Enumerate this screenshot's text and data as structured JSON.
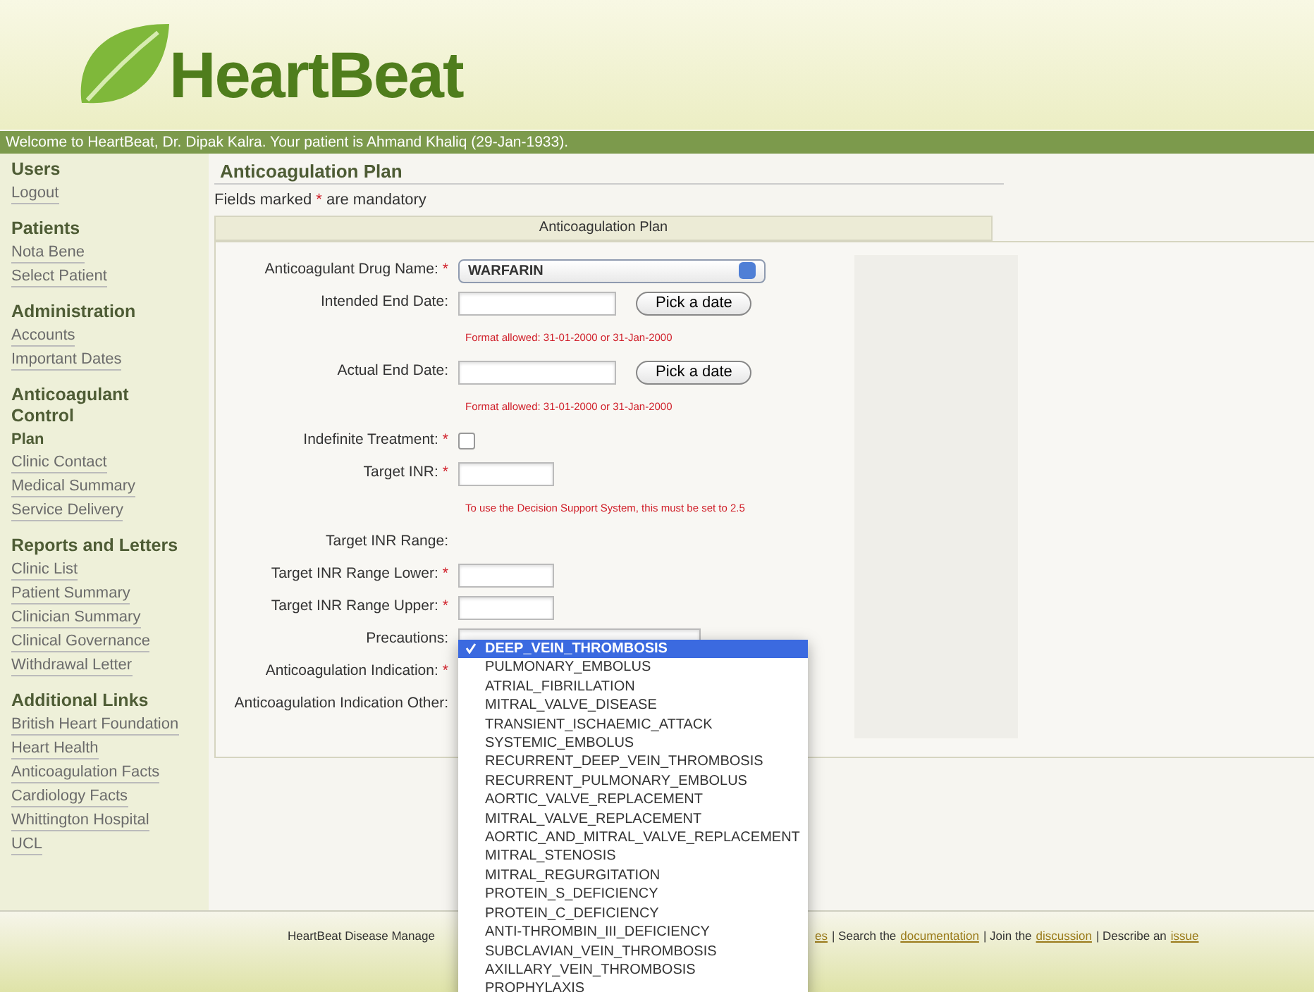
{
  "logo": {
    "text": "HeartBeat"
  },
  "welcome": "Welcome to HeartBeat, Dr. Dipak Kalra. Your patient is Ahmand Khaliq (29-Jan-1933).",
  "sidebar": [
    {
      "heading": "Users",
      "links": [
        {
          "label": "Logout",
          "selected": false
        }
      ]
    },
    {
      "heading": "Patients",
      "links": [
        {
          "label": "Nota Bene",
          "selected": false
        },
        {
          "label": "Select Patient",
          "selected": false
        }
      ]
    },
    {
      "heading": "Administration",
      "links": [
        {
          "label": "Accounts",
          "selected": false
        },
        {
          "label": "Important Dates",
          "selected": false
        }
      ]
    },
    {
      "heading": "Anticoagulant Control",
      "links": [
        {
          "label": "Plan",
          "selected": true
        },
        {
          "label": "Clinic Contact",
          "selected": false
        },
        {
          "label": "Medical Summary",
          "selected": false
        },
        {
          "label": "Service Delivery",
          "selected": false
        }
      ]
    },
    {
      "heading": "Reports and Letters",
      "links": [
        {
          "label": "Clinic List",
          "selected": false
        },
        {
          "label": "Patient Summary",
          "selected": false
        },
        {
          "label": "Clinician Summary",
          "selected": false
        },
        {
          "label": "Clinical Governance",
          "selected": false
        },
        {
          "label": "Withdrawal Letter",
          "selected": false
        }
      ]
    },
    {
      "heading": "Additional Links",
      "links": [
        {
          "label": "British Heart Foundation",
          "selected": false
        },
        {
          "label": "Heart Health",
          "selected": false
        },
        {
          "label": "Anticoagulation Facts",
          "selected": false
        },
        {
          "label": "Cardiology Facts",
          "selected": false
        },
        {
          "label": "Whittington Hospital",
          "selected": false
        },
        {
          "label": "UCL",
          "selected": false
        }
      ]
    }
  ],
  "page_title": "Anticoagulation Plan",
  "mandatory_note": {
    "before": "Fields marked",
    "mark": "*",
    "after": "are mandatory"
  },
  "form": {
    "title": "Anticoagulation Plan",
    "rows": [
      {
        "kind": "select",
        "label": "Anticoagulant Drug Name:",
        "required": true,
        "value": "WARFARIN"
      },
      {
        "kind": "date",
        "label": "Intended End Date:",
        "required": false,
        "button": "Pick a date"
      },
      {
        "kind": "hint",
        "text": "Format allowed: 31-01-2000 or 31-Jan-2000"
      },
      {
        "kind": "date",
        "label": "Actual End Date:",
        "required": false,
        "button": "Pick a date"
      },
      {
        "kind": "hint",
        "text": "Format allowed: 31-01-2000 or 31-Jan-2000"
      },
      {
        "kind": "checkbox",
        "label": "Indefinite Treatment:",
        "required": true,
        "checked": false
      },
      {
        "kind": "short",
        "label": "Target INR:",
        "required": true
      },
      {
        "kind": "hint",
        "text": "To use the Decision Support System, this must be set to 2.5"
      },
      {
        "kind": "label",
        "label": "Target INR Range:",
        "required": false
      },
      {
        "kind": "short",
        "label": "Target INR Range Lower:",
        "required": true
      },
      {
        "kind": "short",
        "label": "Target INR Range Upper:",
        "required": true
      },
      {
        "kind": "wide",
        "label": "Precautions:",
        "required": false
      },
      {
        "kind": "label",
        "label": "Anticoagulation Indication:",
        "required": true
      },
      {
        "kind": "label",
        "label": "Anticoagulation Indication Other:",
        "required": false
      }
    ]
  },
  "indication_options": [
    {
      "label": "DEEP_VEIN_THROMBOSIS",
      "selected": true
    },
    {
      "label": "PULMONARY_EMBOLUS",
      "selected": false
    },
    {
      "label": "ATRIAL_FIBRILLATION",
      "selected": false
    },
    {
      "label": "MITRAL_VALVE_DISEASE",
      "selected": false
    },
    {
      "label": "TRANSIENT_ISCHAEMIC_ATTACK",
      "selected": false
    },
    {
      "label": "SYSTEMIC_EMBOLUS",
      "selected": false
    },
    {
      "label": "RECURRENT_DEEP_VEIN_THROMBOSIS",
      "selected": false
    },
    {
      "label": "RECURRENT_PULMONARY_EMBOLUS",
      "selected": false
    },
    {
      "label": "AORTIC_VALVE_REPLACEMENT",
      "selected": false
    },
    {
      "label": "MITRAL_VALVE_REPLACEMENT",
      "selected": false
    },
    {
      "label": "AORTIC_AND_MITRAL_VALVE_REPLACEMENT",
      "selected": false
    },
    {
      "label": "MITRAL_STENOSIS",
      "selected": false
    },
    {
      "label": "MITRAL_REGURGITATION",
      "selected": false
    },
    {
      "label": "PROTEIN_S_DEFICIENCY",
      "selected": false
    },
    {
      "label": "PROTEIN_C_DEFICIENCY",
      "selected": false
    },
    {
      "label": "ANTI-THROMBIN_III_DEFICIENCY",
      "selected": false
    },
    {
      "label": "SUBCLAVIAN_VEIN_THROMBOSIS",
      "selected": false
    },
    {
      "label": "AXILLARY_VEIN_THROMBOSIS",
      "selected": false
    },
    {
      "label": "PROPHYLAXIS",
      "selected": false
    }
  ],
  "footer": {
    "left": "HeartBeat Disease Manage",
    "right": [
      {
        "text": "es",
        "link": true
      },
      {
        "text": "| Search the",
        "link": false
      },
      {
        "text": "documentation",
        "link": true
      },
      {
        "text": "| Join the",
        "link": false
      },
      {
        "text": "discussion",
        "link": true
      },
      {
        "text": "| Describe an",
        "link": false
      },
      {
        "text": "issue",
        "link": true
      }
    ]
  }
}
